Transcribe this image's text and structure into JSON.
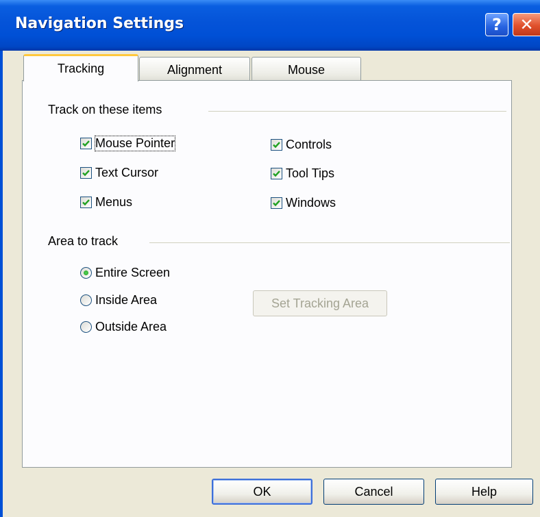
{
  "window": {
    "title": "Navigation Settings",
    "help_glyph": "?",
    "close_glyph": "✕"
  },
  "tabs": [
    {
      "label": "Tracking",
      "active": true
    },
    {
      "label": "Alignment",
      "active": false
    },
    {
      "label": "Mouse",
      "active": false
    }
  ],
  "track_group": {
    "label": "Track on these items",
    "items": [
      {
        "label": "Mouse Pointer",
        "checked": true
      },
      {
        "label": "Text Cursor",
        "checked": true
      },
      {
        "label": "Menus",
        "checked": true
      },
      {
        "label": "Controls",
        "checked": true
      },
      {
        "label": "Tool Tips",
        "checked": true
      },
      {
        "label": "Windows",
        "checked": true
      }
    ]
  },
  "area_group": {
    "label": "Area to track",
    "options": [
      {
        "label": "Entire Screen",
        "selected": true
      },
      {
        "label": "Inside Area",
        "selected": false
      },
      {
        "label": "Outside Area",
        "selected": false
      }
    ],
    "set_area_button": "Set Tracking Area"
  },
  "buttons": {
    "ok": "OK",
    "cancel": "Cancel",
    "help": "Help"
  },
  "colors": {
    "titlebar": "#0050d6",
    "dialog_bg": "#ece9d8",
    "panel_bg": "#fcfcfe",
    "check": "#21a121",
    "tab_accent": "#ffc83c"
  }
}
